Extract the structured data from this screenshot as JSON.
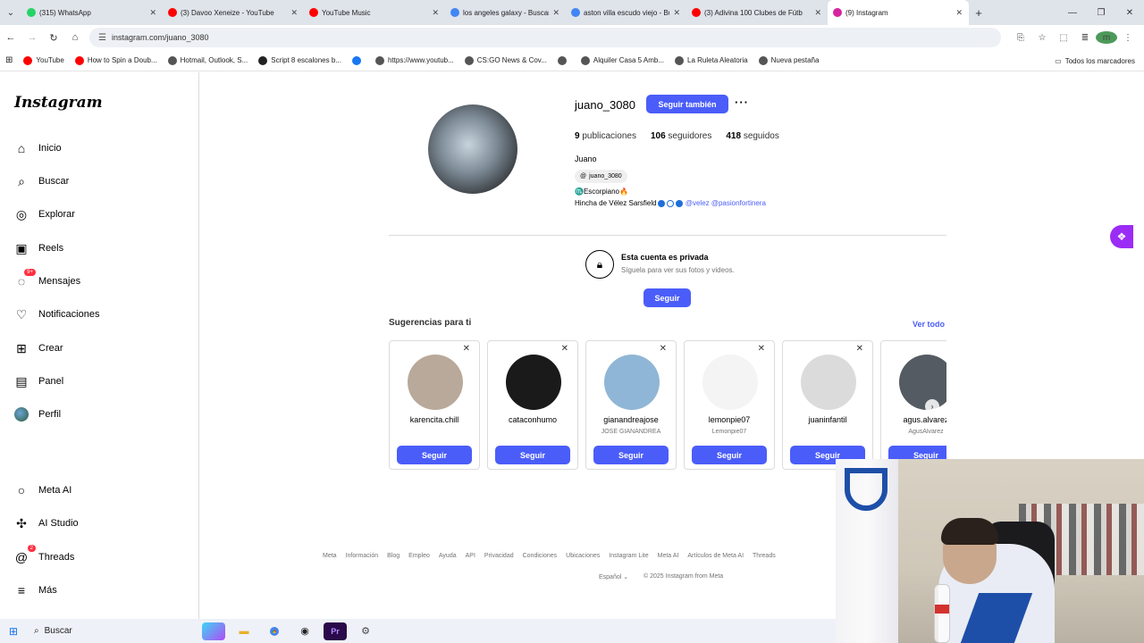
{
  "browser": {
    "tabs": [
      {
        "title": "(315) WhatsApp",
        "fav_color": "#25d366"
      },
      {
        "title": "(3) Davoo Xeneize - YouTube",
        "fav_color": "#ff0000"
      },
      {
        "title": "YouTube Music",
        "fav_color": "#ff0000"
      },
      {
        "title": "los angeles galaxy - Buscar con",
        "fav_color": "#4285f4"
      },
      {
        "title": "aston villa escudo viejo - Busca",
        "fav_color": "#4285f4"
      },
      {
        "title": "(3) Adivina 100 Clubes de Fútb",
        "fav_color": "#ff0000"
      },
      {
        "title": "(9) Instagram",
        "fav_color": "#d6249f"
      }
    ],
    "url": "instagram.com/juano_3080",
    "profile_initial": "m",
    "bookmarks": [
      {
        "label": "YouTube",
        "color": "#ff0000"
      },
      {
        "label": "How to Spin a Doub...",
        "color": "#ff0000"
      },
      {
        "label": "Hotmail, Outlook, S...",
        "color": "#555555"
      },
      {
        "label": "Script 8 escalones b...",
        "color": "#222222"
      },
      {
        "label": "",
        "color": "#1877f2"
      },
      {
        "label": "https://www.youtub...",
        "color": "#555555"
      },
      {
        "label": "CS:GO News & Cov...",
        "color": "#555555"
      },
      {
        "label": "",
        "color": "#555555"
      },
      {
        "label": "Alquiler Casa 5 Amb...",
        "color": "#555555"
      },
      {
        "label": "La Ruleta Aleatoria",
        "color": "#555555"
      },
      {
        "label": "Nueva pestaña",
        "color": "#555555"
      }
    ],
    "all_bookmarks": "Todos los marcadores"
  },
  "sidebar": {
    "logo": "Instagram",
    "items": [
      {
        "label": "Inicio",
        "icon": "home-icon",
        "glyph": "⌂"
      },
      {
        "label": "Buscar",
        "icon": "search-icon",
        "glyph": "⌕"
      },
      {
        "label": "Explorar",
        "icon": "compass-icon",
        "glyph": "◎"
      },
      {
        "label": "Reels",
        "icon": "reels-icon",
        "glyph": "▣"
      },
      {
        "label": "Mensajes",
        "icon": "messenger-icon",
        "glyph": "◌",
        "badge": "9+"
      },
      {
        "label": "Notificaciones",
        "icon": "heart-icon",
        "glyph": "♡"
      },
      {
        "label": "Crear",
        "icon": "create-icon",
        "glyph": "⊞"
      },
      {
        "label": "Panel",
        "icon": "dashboard-icon",
        "glyph": "▤"
      },
      {
        "label": "Perfil",
        "icon": "profile-avatar",
        "glyph": ""
      },
      {
        "label": "Meta AI",
        "icon": "meta-ai-icon",
        "glyph": "○"
      },
      {
        "label": "AI Studio",
        "icon": "ai-studio-icon",
        "glyph": "✣"
      },
      {
        "label": "Threads",
        "icon": "threads-icon",
        "glyph": "@",
        "badge": "2"
      },
      {
        "label": "Más",
        "icon": "menu-icon",
        "glyph": "≡"
      }
    ]
  },
  "profile": {
    "username": "juano_3080",
    "follow_also_label": "Seguir también",
    "more_label": "···",
    "posts": "9",
    "posts_label": "publicaciones",
    "followers": "106",
    "followers_label": "seguidores",
    "following": "418",
    "following_label": "seguidos",
    "full_name": "Juano",
    "threads_handle": "juano_3080",
    "bio_line1": "♏Escorpiano🔥",
    "bio_line2_text": "Hincha de Vélez Sarsfield",
    "bio_line2_links": "@velez @pasionfortinera",
    "dot_colors": [
      "#1e6fd9",
      "#ffffff",
      "#1e6fd9"
    ],
    "private_title": "Esta cuenta es privada",
    "private_sub": "Síguela para ver sus fotos y videos.",
    "follow_label": "Seguir"
  },
  "suggestions": {
    "title": "Sugerencias para ti",
    "see_all": "Ver todo",
    "cards": [
      {
        "name": "karencita.chill",
        "sub": "",
        "button": "Seguir",
        "avatar_color": "#b8a99a"
      },
      {
        "name": "cataconhumo",
        "sub": "",
        "button": "Seguir",
        "avatar_color": "#1a1a1a"
      },
      {
        "name": "gianandreajose",
        "sub": "JOSE GIANANDREA",
        "button": "Seguir",
        "avatar_color": "#8fb6d6"
      },
      {
        "name": "lemonpie07",
        "sub": "Lemonpie07",
        "button": "Seguir",
        "avatar_color": "#f4f4f4"
      },
      {
        "name": "juaninfantil",
        "sub": "",
        "button": "Seguir",
        "avatar_color": "#dbdbdb"
      },
      {
        "name": "agus.alvarez",
        "sub": "AgusAlvarez",
        "button": "Seguir",
        "avatar_color": "#555b62"
      }
    ]
  },
  "footer": {
    "links": [
      "Meta",
      "Información",
      "Blog",
      "Empleo",
      "Ayuda",
      "API",
      "Privacidad",
      "Condiciones",
      "Ubicaciones",
      "Instagram Lite",
      "Meta AI",
      "Artículos de Meta AI",
      "Threads"
    ],
    "language": "Español",
    "copyright": "© 2025 Instagram from Meta"
  },
  "taskbar": {
    "search_label": "Buscar"
  }
}
